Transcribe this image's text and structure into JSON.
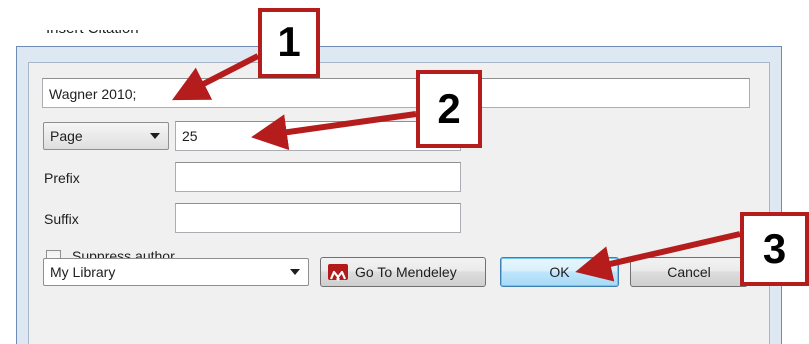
{
  "window": {
    "title": "Insert Citation"
  },
  "citation": {
    "value": "Wagner 2010;"
  },
  "locator": {
    "type_selected": "Page",
    "value": "25"
  },
  "prefix": {
    "label": "Prefix",
    "value": ""
  },
  "suffix": {
    "label": "Suffix",
    "value": ""
  },
  "suppress_author": {
    "label": "Suppress author",
    "checked": false
  },
  "library": {
    "selected": "My Library"
  },
  "buttons": {
    "go_to_mendeley": "Go To Mendeley",
    "ok": "OK",
    "cancel": "Cancel"
  },
  "callouts": {
    "one": "1",
    "two": "2",
    "three": "3"
  },
  "colors": {
    "callout_red": "#b51c1c",
    "mendeley_red": "#b31b1b",
    "ok_blue": "#3c7fb1"
  }
}
